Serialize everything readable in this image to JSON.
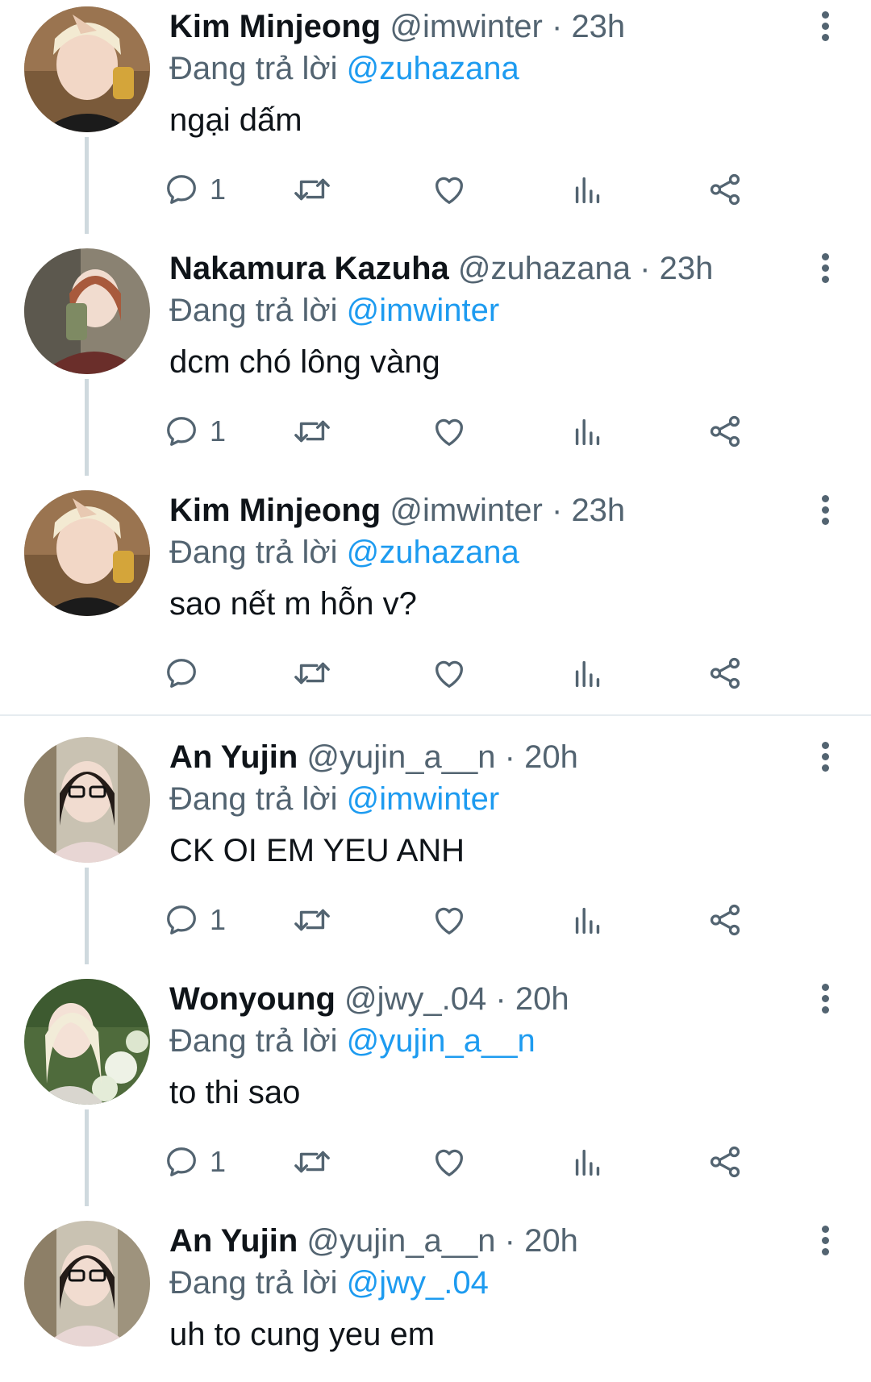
{
  "labels": {
    "replying_to": "Đang trả lời"
  },
  "colors": {
    "mention": "#1d9bf0",
    "secondary_text": "#536471",
    "thread_line": "#cfd9de"
  },
  "tweets": [
    {
      "name": "Kim Minjeong",
      "handle": "@imwinter",
      "dot": "·",
      "time": "23h",
      "reply_to": "@zuhazana",
      "text": "ngại dấm",
      "reply_count": "1",
      "avatar": "avatar-kim-minjeong"
    },
    {
      "name": "Nakamura Kazuha",
      "handle": "@zuhazana",
      "dot": "·",
      "time": "23h",
      "reply_to": "@imwinter",
      "text": "dcm chó lông vàng",
      "reply_count": "1",
      "avatar": "avatar-nakamura-kazuha"
    },
    {
      "name": "Kim Minjeong",
      "handle": "@imwinter",
      "dot": "·",
      "time": "23h",
      "reply_to": "@zuhazana",
      "text": "sao nết m hỗn v?",
      "reply_count": "",
      "avatar": "avatar-kim-minjeong"
    },
    {
      "name": "An Yujin",
      "handle": "@yujin_a__n",
      "dot": "·",
      "time": "20h",
      "reply_to": "@imwinter",
      "text": "CK OI EM YEU ANH",
      "reply_count": "1",
      "avatar": "avatar-an-yujin"
    },
    {
      "name": "Wonyoung",
      "handle": "@jwy_.04",
      "dot": "·",
      "time": "20h",
      "reply_to": "@yujin_a__n",
      "text": "to thi sao",
      "reply_count": "1",
      "avatar": "avatar-wonyoung"
    },
    {
      "name": "An Yujin",
      "handle": "@yujin_a__n",
      "dot": "·",
      "time": "20h",
      "reply_to": "@jwy_.04",
      "text": "uh to cung yeu em",
      "reply_count": "",
      "avatar": "avatar-an-yujin"
    }
  ],
  "icons": [
    "reply-icon",
    "retweet-icon",
    "like-icon",
    "views-icon",
    "share-icon",
    "more-icon"
  ]
}
